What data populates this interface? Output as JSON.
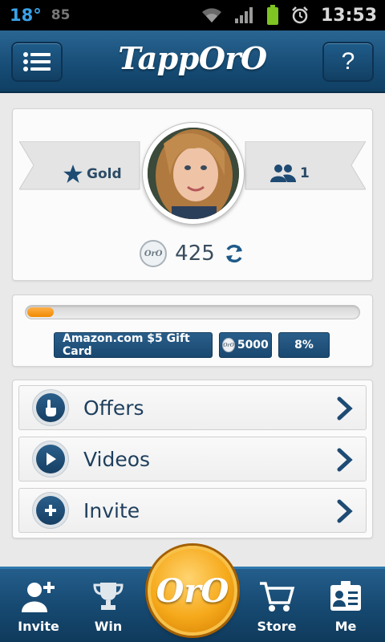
{
  "status_bar": {
    "temperature": "18°",
    "notification_count": "85",
    "time": "13:53"
  },
  "header": {
    "app_title": "TappOrO",
    "help_label": "?"
  },
  "profile": {
    "tier": "Gold",
    "friends": "1",
    "coins": "425",
    "coin_icon_text": "OrO"
  },
  "progress": {
    "fraction": 0.08,
    "reward": "Amazon.com $5 Gift Card",
    "cost": "5000",
    "percent": "8%"
  },
  "menu": {
    "items": [
      {
        "label": "Offers"
      },
      {
        "label": "Videos"
      },
      {
        "label": "Invite"
      }
    ]
  },
  "tabbar": {
    "invite": "Invite",
    "win": "Win",
    "center": "OrO",
    "store": "Store",
    "me": "Me"
  },
  "colors": {
    "brand_blue": "#1a4870",
    "accent_orange": "#f08a00",
    "text_dark": "#1f3f5d"
  }
}
